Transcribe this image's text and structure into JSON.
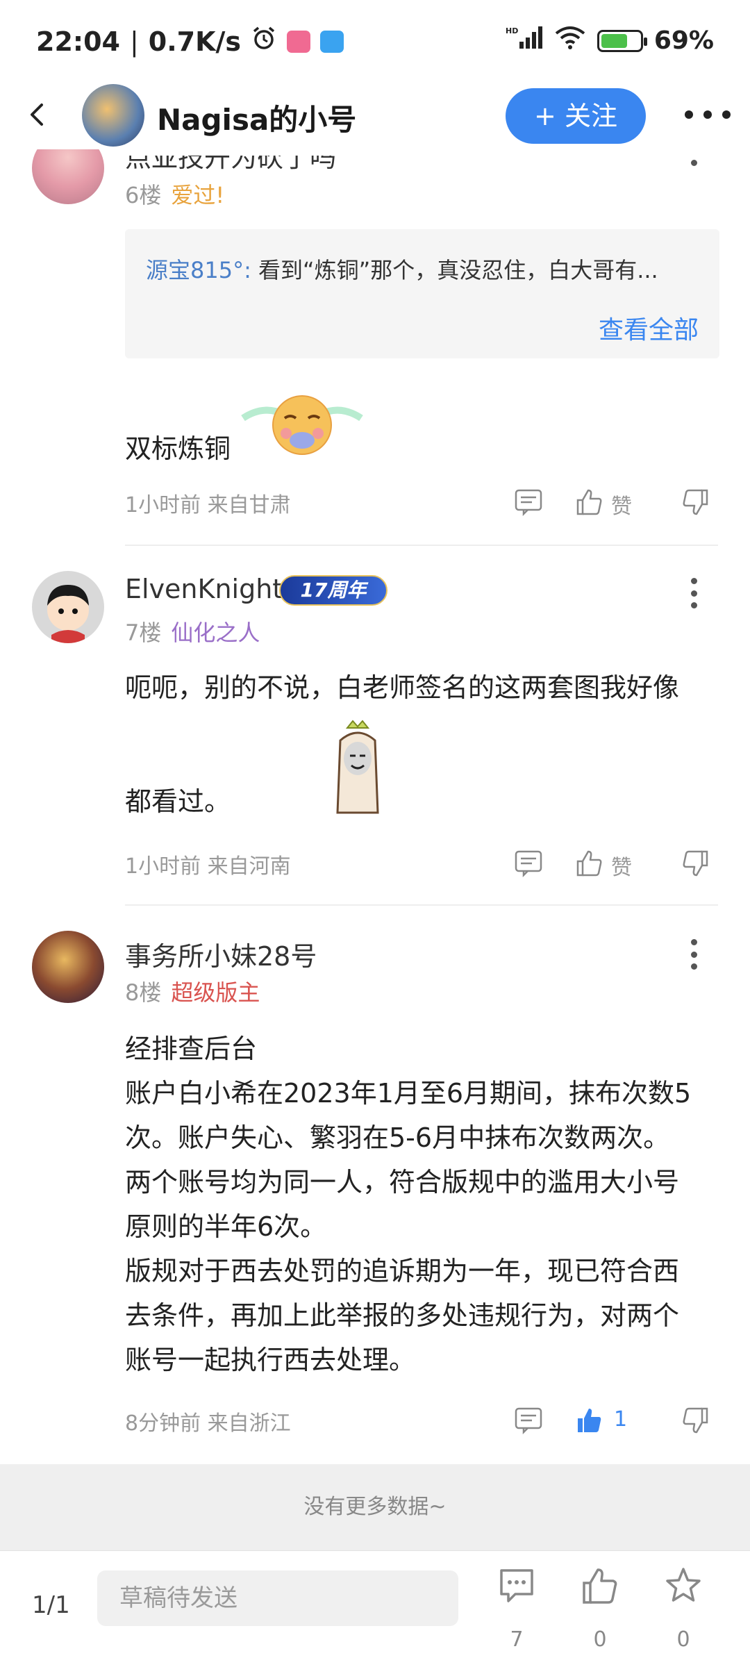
{
  "status_bar": {
    "time": "22:04",
    "speed": "0.7K/s",
    "battery": "69%",
    "battery_level": 0.69,
    "network": "HD"
  },
  "header": {
    "title": "Nagisa的小号",
    "follow_label": "+ 关注"
  },
  "floors": [
    {
      "username": "点亚技开为砍了吗",
      "floor": "6楼",
      "tag": "爱过!",
      "tag_color": "#e8a33d",
      "quote": {
        "user": "源宝815°:",
        "text": " 看到“炼铜”那个，真没忍住，白大哥有...",
        "more_label": "查看全部"
      },
      "content": "双标炼铜",
      "time": "1小时前 来自甘肃",
      "like_label": "赞"
    },
    {
      "username": "ElvenKnight",
      "badge": "17周年",
      "floor": "7楼",
      "tag": "仙化之人",
      "tag_color": "#9a6fc8",
      "content_line1": "呃呃，别的不说，白老师签名的这两套图我好像",
      "content_line2": "都看过。",
      "time": "1小时前 来自河南",
      "like_label": "赞"
    },
    {
      "username": "事务所小妹28号",
      "floor": "8楼",
      "tag": "超级版主",
      "tag_color": "#d9534f",
      "content_lines": [
        "经排查后台",
        "账户白小希在2023年1月至6月期间，抹布次数5",
        "次。账户失心、繁羽在5-6月中抹布次数两次。",
        "两个账号均为同一人，符合版规中的滥用大小号",
        "原则的半年6次。",
        "版规对于西去处罚的追诉期为一年，现已符合西",
        "去条件，再加上此举报的多处违规行为，对两个",
        "账号一起执行西去处理。"
      ],
      "time": "8分钟前 来自浙江",
      "like_count": "1",
      "like_color": "#3a86f0"
    }
  ],
  "no_more": "没有更多数据~",
  "bottom_bar": {
    "page": "1/1",
    "draft_placeholder": "草稿待发送",
    "comments": "7",
    "likes": "0",
    "favorites": "0"
  }
}
